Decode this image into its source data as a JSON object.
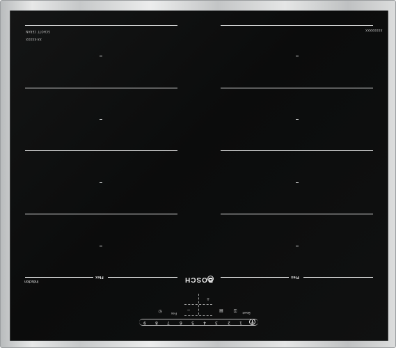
{
  "brand": {
    "name": "BOSCH",
    "glass_maker": "SCHOTT CERAN",
    "glass_code": "XX-XXXXX",
    "model_code": "XXXXXXXX",
    "type_label": "Induction"
  },
  "zones": {
    "left_flex_label": "Flex",
    "right_flex_label": "Flex",
    "zone_marker": "—"
  },
  "controls": {
    "timer_icon": "clock-icon",
    "flex_toggle_label": "Flex",
    "minus_label": "−",
    "plus_label": "+",
    "pan_icon": "pan-icon",
    "lock_icon": "child-lock-icon",
    "boost_label": "Boost",
    "slider_levels": [
      "0",
      "1",
      "2",
      "3",
      "4",
      "5",
      "6",
      "7",
      "8",
      "9"
    ],
    "power_icon": "power-icon"
  }
}
